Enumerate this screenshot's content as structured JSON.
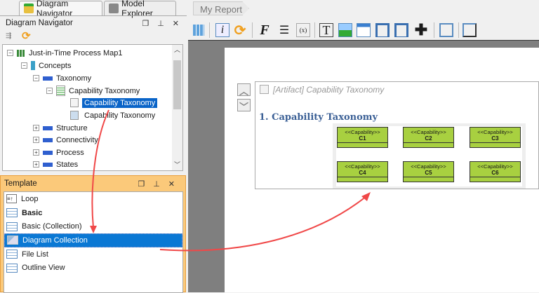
{
  "tabs": [
    {
      "label": "Diagram Navigator",
      "active": true
    },
    {
      "label": "Model Explorer",
      "active": false
    }
  ],
  "navigator": {
    "title": "Diagram Navigator",
    "tree": [
      {
        "label": "Just-in-Time Process Map1",
        "level": 0,
        "toggle": "-"
      },
      {
        "label": "Concepts",
        "level": 1,
        "toggle": "-"
      },
      {
        "label": "Taxonomy",
        "level": 2,
        "toggle": "-"
      },
      {
        "label": "Capability Taxonomy",
        "level": 3,
        "toggle": "-"
      },
      {
        "label": "Capability Taxonomy",
        "level": 4,
        "selected": true
      },
      {
        "label": "Capability Taxonomy",
        "level": 4
      },
      {
        "label": "Structure",
        "level": 2,
        "toggle": "+"
      },
      {
        "label": "Connectivity",
        "level": 2,
        "toggle": "+"
      },
      {
        "label": "Process",
        "level": 2,
        "toggle": "+"
      },
      {
        "label": "States",
        "level": 2,
        "toggle": "+"
      }
    ]
  },
  "template": {
    "title": "Template",
    "items": [
      {
        "label": "Loop"
      },
      {
        "label": "Basic",
        "bold": true
      },
      {
        "label": "Basic (Collection)"
      },
      {
        "label": "Diagram Collection",
        "selected": true
      },
      {
        "label": "File List"
      },
      {
        "label": "Outline View"
      }
    ]
  },
  "report": {
    "breadcrumb": "My Report",
    "element_label": "[Artifact] Capability Taxonomy",
    "heading": "1. Capability Taxonomy",
    "stereotype": "<<Capability>>",
    "capabilities": [
      "C1",
      "C2",
      "C3",
      "C4",
      "C5",
      "C6"
    ]
  },
  "colors": {
    "selection": "#0a64c8",
    "capability": "#a8d040",
    "heading": "#3a5f95",
    "arrow": "#f04040",
    "template_header": "#fbc97a"
  }
}
